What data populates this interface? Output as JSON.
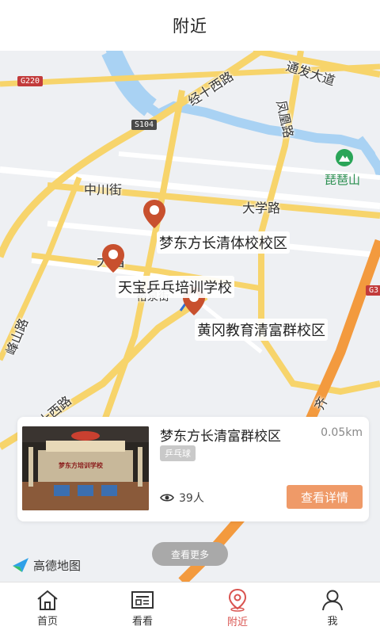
{
  "header": {
    "title": "附近"
  },
  "map": {
    "roads": [
      "经十西路",
      "通发大道",
      "凤凰路",
      "中川街",
      "大学路",
      "峰山路",
      "经十西路",
      "齐"
    ],
    "route_shields": [
      "G220",
      "S104",
      "G3"
    ],
    "labels_partial": [
      "大昌",
      "裕泉街"
    ],
    "park": "琵琶山",
    "pois": [
      "梦东方长清体校校区",
      "天宝乒乓培训学校",
      "黄冈教育清富群校区"
    ],
    "attribution": "高德地图",
    "colors": {
      "road_major": "#f7d46b",
      "road_express": "#f39a3e",
      "water": "#a9d2f3",
      "pin": "#c8502e"
    }
  },
  "card": {
    "name": "梦东方长清富群校区",
    "distance": "0.05km",
    "tag": "乒乓球",
    "views": "39人",
    "thumb_sign": "梦东方培训学校",
    "detail_button": "查看详情"
  },
  "more_button": "查看更多",
  "tabbar": {
    "items": [
      {
        "label": "首页",
        "icon": "home-icon"
      },
      {
        "label": "看看",
        "icon": "news-icon"
      },
      {
        "label": "附近",
        "icon": "location-pin-icon"
      },
      {
        "label": "我",
        "icon": "user-icon"
      }
    ],
    "active_index": 2,
    "active_color": "#d9534f"
  }
}
